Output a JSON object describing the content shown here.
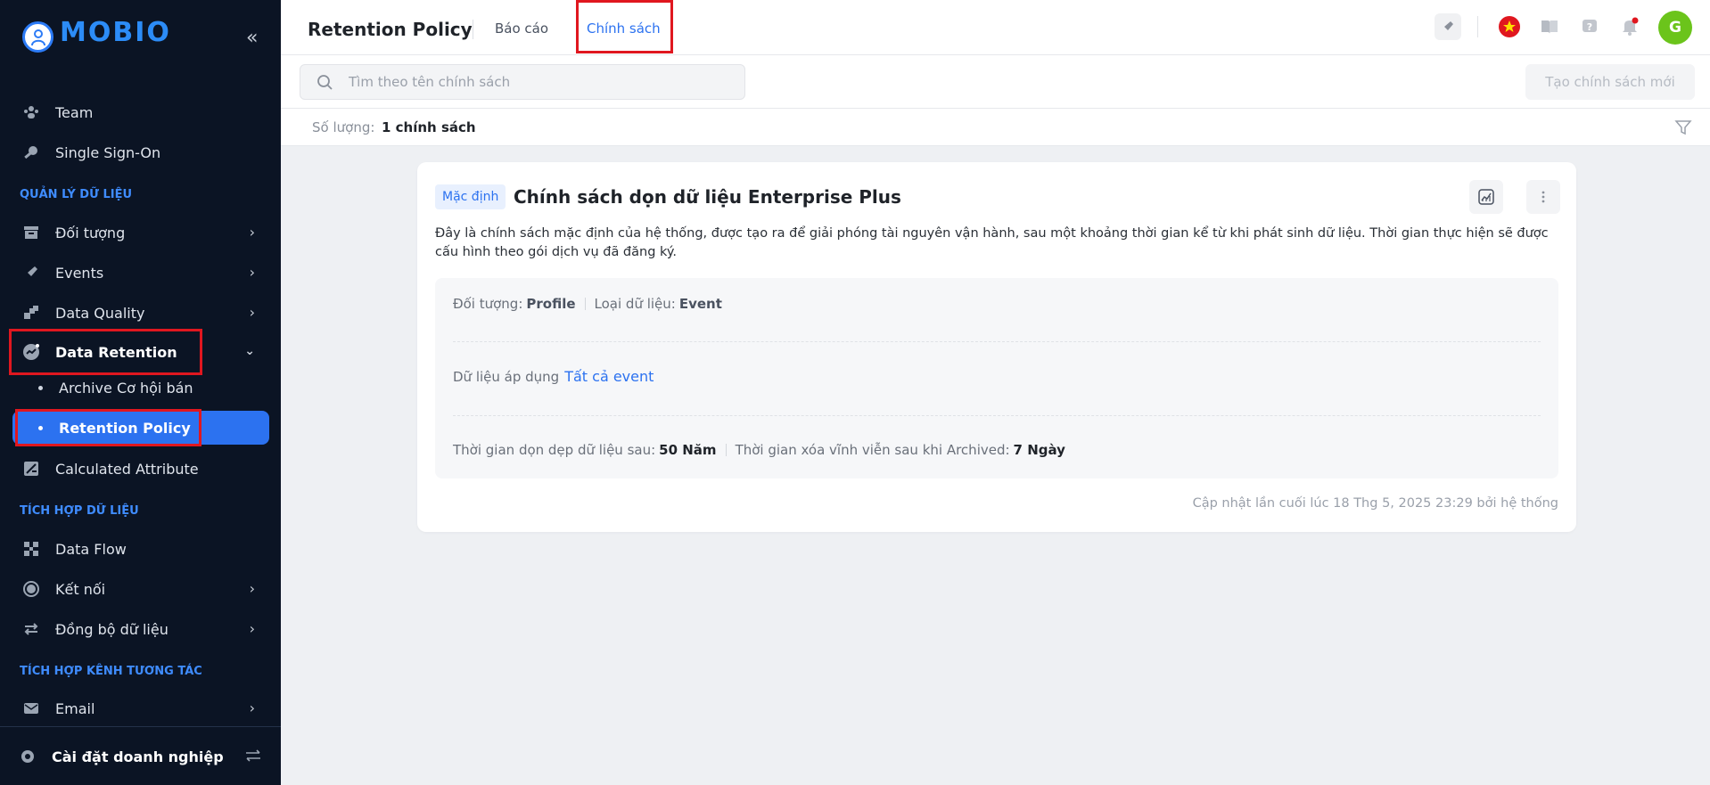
{
  "sidebar": {
    "logo_text": "MOBIO",
    "collapse_icon": "double-chevron-left-icon",
    "items_top": [
      {
        "label": "Team",
        "icon": "team-icon"
      },
      {
        "label": "Single Sign-On",
        "icon": "key-icon"
      }
    ],
    "section_data": "QUẢN LÝ DỮ LIỆU",
    "data_items": [
      {
        "label": "Đối tượng",
        "icon": "archive-box-icon"
      },
      {
        "label": "Events",
        "icon": "rocket-icon"
      },
      {
        "label": "Data Quality",
        "icon": "blocks-icon"
      },
      {
        "label": "Data Retention",
        "icon": "retention-icon"
      }
    ],
    "sub_items": [
      {
        "label": "Archive Cơ hội bán"
      },
      {
        "label": "Retention Policy"
      }
    ],
    "calc_item": {
      "label": "Calculated Attribute",
      "icon": "calc-icon"
    },
    "section_integration": "TÍCH HỢP DỮ LIỆU",
    "integration_items": [
      {
        "label": "Data Flow",
        "icon": "flow-icon"
      },
      {
        "label": "Kết nối",
        "icon": "connect-icon"
      },
      {
        "label": "Đồng bộ dữ liệu",
        "icon": "sync-icon"
      }
    ],
    "section_channel": "TÍCH HỢP KÊNH TƯƠNG TÁC",
    "channel_items": [
      {
        "label": "Email",
        "icon": "email-icon"
      }
    ],
    "bottom_label": "Cài đặt doanh nghiệp",
    "bottom_icon": "gear-icon",
    "bottom_switch_icon": "switch-arrows-icon"
  },
  "header": {
    "title": "Retention Policy",
    "tabs": [
      {
        "label": "Báo cáo"
      },
      {
        "label": "Chính sách"
      }
    ],
    "avatar_letter": "G",
    "icons": [
      "rocket-icon",
      "flag-vn-icon",
      "book-icon",
      "help-icon",
      "bell-icon"
    ]
  },
  "toolbar": {
    "search_placeholder": "Tìm theo tên chính sách",
    "create_label": "Tạo chính sách mới"
  },
  "countbar": {
    "label": "Số lượng:",
    "value": "1 chính sách"
  },
  "policy": {
    "badge": "Mặc định",
    "title": "Chính sách dọn dữ liệu Enterprise Plus",
    "description": "Đây là chính sách mặc định của hệ thống, được tạo ra để giải phóng tài nguyên vận hành, sau một khoảng thời gian kể từ khi phát sinh dữ liệu. Thời gian thực hiện sẽ được cấu hình theo gói dịch vụ đã đăng ký.",
    "object_label": "Đối tượng:",
    "object_value": "Profile",
    "type_label": "Loại dữ liệu:",
    "type_value": "Event",
    "applied_label": "Dữ liệu áp dụng",
    "applied_value": "Tất cả event",
    "cleanup_label": "Thời gian dọn dẹp dữ liệu sau:",
    "cleanup_value": "50 Năm",
    "delete_label": "Thời gian xóa vĩnh viễn sau khi Archived:",
    "delete_value": "7 Ngày",
    "footer": "Cập nhật lần cuối lúc 18 Thg 5, 2025 23:29 bởi hệ thống"
  },
  "colors": {
    "sidebar_bg": "#0b1424",
    "accent": "#2c72f0",
    "highlight_box": "#e0171f",
    "avatar": "#6bc41b"
  }
}
